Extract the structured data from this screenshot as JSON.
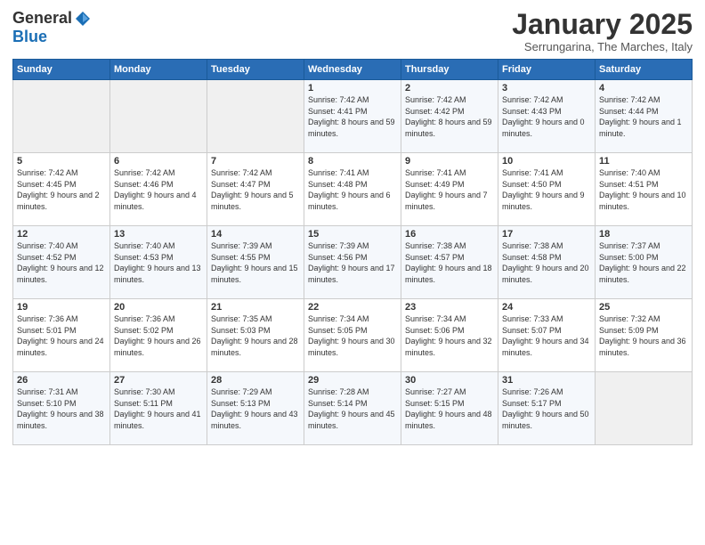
{
  "header": {
    "logo_general": "General",
    "logo_blue": "Blue",
    "title": "January 2025",
    "location": "Serrungarina, The Marches, Italy"
  },
  "days_of_week": [
    "Sunday",
    "Monday",
    "Tuesday",
    "Wednesday",
    "Thursday",
    "Friday",
    "Saturday"
  ],
  "weeks": [
    [
      {
        "day": "",
        "info": ""
      },
      {
        "day": "",
        "info": ""
      },
      {
        "day": "",
        "info": ""
      },
      {
        "day": "1",
        "info": "Sunrise: 7:42 AM\nSunset: 4:41 PM\nDaylight: 8 hours and 59 minutes."
      },
      {
        "day": "2",
        "info": "Sunrise: 7:42 AM\nSunset: 4:42 PM\nDaylight: 8 hours and 59 minutes."
      },
      {
        "day": "3",
        "info": "Sunrise: 7:42 AM\nSunset: 4:43 PM\nDaylight: 9 hours and 0 minutes."
      },
      {
        "day": "4",
        "info": "Sunrise: 7:42 AM\nSunset: 4:44 PM\nDaylight: 9 hours and 1 minute."
      }
    ],
    [
      {
        "day": "5",
        "info": "Sunrise: 7:42 AM\nSunset: 4:45 PM\nDaylight: 9 hours and 2 minutes."
      },
      {
        "day": "6",
        "info": "Sunrise: 7:42 AM\nSunset: 4:46 PM\nDaylight: 9 hours and 4 minutes."
      },
      {
        "day": "7",
        "info": "Sunrise: 7:42 AM\nSunset: 4:47 PM\nDaylight: 9 hours and 5 minutes."
      },
      {
        "day": "8",
        "info": "Sunrise: 7:41 AM\nSunset: 4:48 PM\nDaylight: 9 hours and 6 minutes."
      },
      {
        "day": "9",
        "info": "Sunrise: 7:41 AM\nSunset: 4:49 PM\nDaylight: 9 hours and 7 minutes."
      },
      {
        "day": "10",
        "info": "Sunrise: 7:41 AM\nSunset: 4:50 PM\nDaylight: 9 hours and 9 minutes."
      },
      {
        "day": "11",
        "info": "Sunrise: 7:40 AM\nSunset: 4:51 PM\nDaylight: 9 hours and 10 minutes."
      }
    ],
    [
      {
        "day": "12",
        "info": "Sunrise: 7:40 AM\nSunset: 4:52 PM\nDaylight: 9 hours and 12 minutes."
      },
      {
        "day": "13",
        "info": "Sunrise: 7:40 AM\nSunset: 4:53 PM\nDaylight: 9 hours and 13 minutes."
      },
      {
        "day": "14",
        "info": "Sunrise: 7:39 AM\nSunset: 4:55 PM\nDaylight: 9 hours and 15 minutes."
      },
      {
        "day": "15",
        "info": "Sunrise: 7:39 AM\nSunset: 4:56 PM\nDaylight: 9 hours and 17 minutes."
      },
      {
        "day": "16",
        "info": "Sunrise: 7:38 AM\nSunset: 4:57 PM\nDaylight: 9 hours and 18 minutes."
      },
      {
        "day": "17",
        "info": "Sunrise: 7:38 AM\nSunset: 4:58 PM\nDaylight: 9 hours and 20 minutes."
      },
      {
        "day": "18",
        "info": "Sunrise: 7:37 AM\nSunset: 5:00 PM\nDaylight: 9 hours and 22 minutes."
      }
    ],
    [
      {
        "day": "19",
        "info": "Sunrise: 7:36 AM\nSunset: 5:01 PM\nDaylight: 9 hours and 24 minutes."
      },
      {
        "day": "20",
        "info": "Sunrise: 7:36 AM\nSunset: 5:02 PM\nDaylight: 9 hours and 26 minutes."
      },
      {
        "day": "21",
        "info": "Sunrise: 7:35 AM\nSunset: 5:03 PM\nDaylight: 9 hours and 28 minutes."
      },
      {
        "day": "22",
        "info": "Sunrise: 7:34 AM\nSunset: 5:05 PM\nDaylight: 9 hours and 30 minutes."
      },
      {
        "day": "23",
        "info": "Sunrise: 7:34 AM\nSunset: 5:06 PM\nDaylight: 9 hours and 32 minutes."
      },
      {
        "day": "24",
        "info": "Sunrise: 7:33 AM\nSunset: 5:07 PM\nDaylight: 9 hours and 34 minutes."
      },
      {
        "day": "25",
        "info": "Sunrise: 7:32 AM\nSunset: 5:09 PM\nDaylight: 9 hours and 36 minutes."
      }
    ],
    [
      {
        "day": "26",
        "info": "Sunrise: 7:31 AM\nSunset: 5:10 PM\nDaylight: 9 hours and 38 minutes."
      },
      {
        "day": "27",
        "info": "Sunrise: 7:30 AM\nSunset: 5:11 PM\nDaylight: 9 hours and 41 minutes."
      },
      {
        "day": "28",
        "info": "Sunrise: 7:29 AM\nSunset: 5:13 PM\nDaylight: 9 hours and 43 minutes."
      },
      {
        "day": "29",
        "info": "Sunrise: 7:28 AM\nSunset: 5:14 PM\nDaylight: 9 hours and 45 minutes."
      },
      {
        "day": "30",
        "info": "Sunrise: 7:27 AM\nSunset: 5:15 PM\nDaylight: 9 hours and 48 minutes."
      },
      {
        "day": "31",
        "info": "Sunrise: 7:26 AM\nSunset: 5:17 PM\nDaylight: 9 hours and 50 minutes."
      },
      {
        "day": "",
        "info": ""
      }
    ]
  ]
}
